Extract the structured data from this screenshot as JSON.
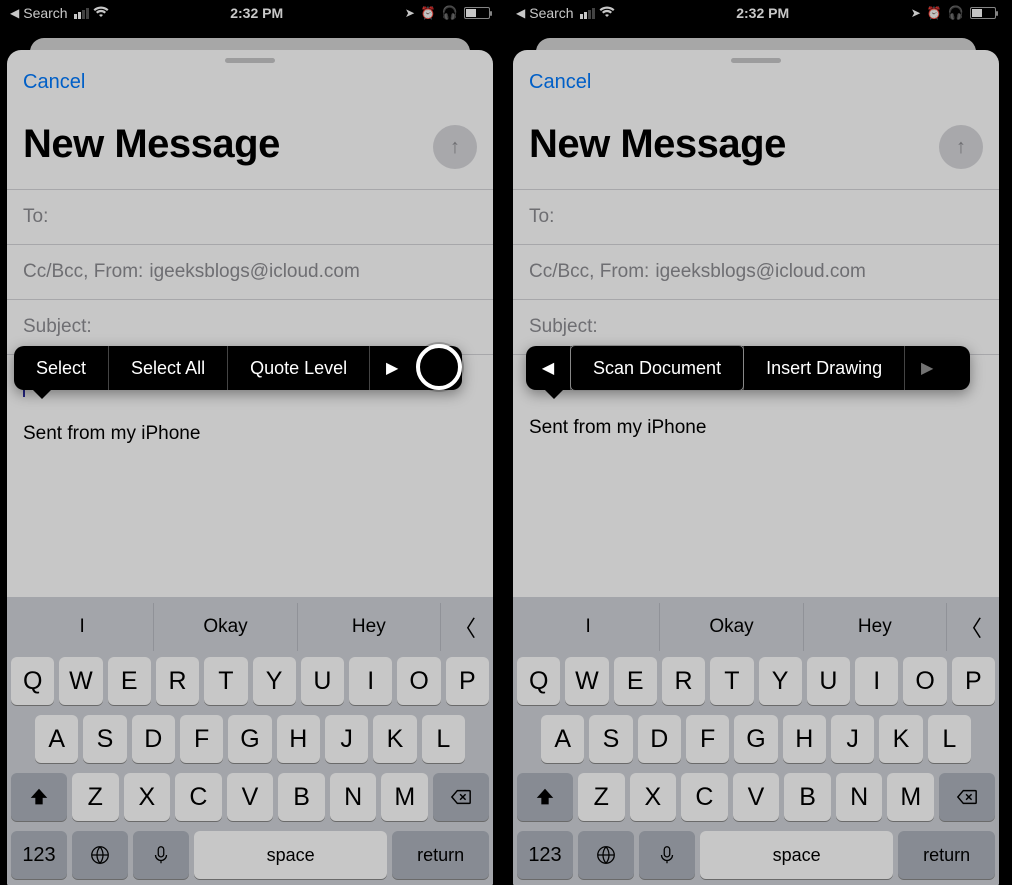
{
  "statusbar": {
    "back_label": "Search",
    "time": "2:32 PM"
  },
  "compose": {
    "cancel": "Cancel",
    "title": "New Message",
    "to_label": "To:",
    "cc_label": "Cc/Bcc, From:",
    "from_value": "igeeksblogs@icloud.com",
    "subject_label": "Subject:",
    "signature": "Sent from my iPhone"
  },
  "context_menu_left": {
    "items": [
      "Select",
      "Select All",
      "Quote Level"
    ]
  },
  "context_menu_right": {
    "items": [
      "Scan Document",
      "Insert Drawing"
    ]
  },
  "keyboard": {
    "predictions": [
      "I",
      "Okay",
      "Hey"
    ],
    "row1": [
      "Q",
      "W",
      "E",
      "R",
      "T",
      "Y",
      "U",
      "I",
      "O",
      "P"
    ],
    "row2": [
      "A",
      "S",
      "D",
      "F",
      "G",
      "H",
      "J",
      "K",
      "L"
    ],
    "row3": [
      "Z",
      "X",
      "C",
      "V",
      "B",
      "N",
      "M"
    ],
    "numeric": "123",
    "space": "space",
    "ret": "return"
  }
}
